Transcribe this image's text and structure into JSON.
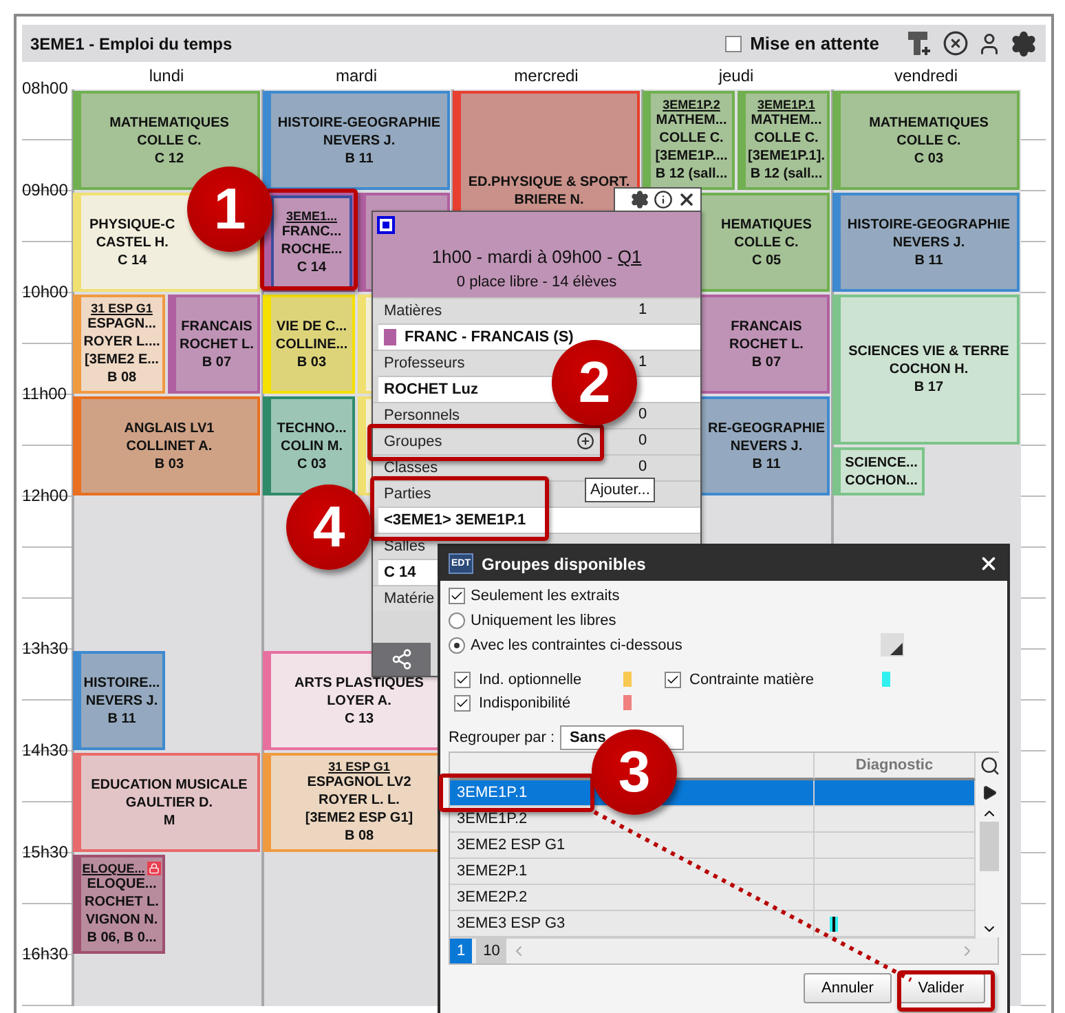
{
  "window": {
    "title": "3EME1 - Emploi du temps",
    "hold": {
      "label": "Mise en attente",
      "checked": false
    }
  },
  "timetable": {
    "days": [
      "lundi",
      "mardi",
      "mercredi",
      "jeudi",
      "vendredi"
    ],
    "periods": [
      {
        "time": "08h00",
        "lessons_by_day": {
          "day_1": [
            {
              "kind": "hour",
              "color": "#a5c196",
              "bar": {
                "color": "#70b050"
              },
              "selected": false,
              "locked": false,
              "lines": [
                "MATHEMATIQUES",
                "COLLE C.",
                "C 12"
              ]
            }
          ],
          "day_2": [
            {
              "kind": "hour",
              "color": "#94a9bf",
              "bar": {
                "color": "#3e8ad0"
              },
              "selected": false,
              "locked": false,
              "lines": [
                "HISTOIRE-GEOGRAPHIE",
                "NEVERS J.",
                "B 11"
              ]
            }
          ],
          "day_3": [
            {
              "kind": "double",
              "color": "#c99189",
              "bar": {
                "color": "#e84030"
              },
              "selected": false,
              "locked": false,
              "lines": [
                "ED.PHYSIQUE & SPORT.",
                "BRIERE N."
              ]
            }
          ],
          "day_4": [
            {
              "kind": "half-left",
              "color": "#a5c196",
              "bar": {
                "color": "#70b050"
              },
              "selected": false,
              "locked": false,
              "header": "3EME1P.2",
              "lines": [
                "MATHEM...",
                "COLLE C.",
                "[3EME1P....",
                "B 12 (sall..."
              ]
            },
            {
              "kind": "half-right",
              "color": "#a5c196",
              "bar": {
                "color": "#70b050"
              },
              "selected": false,
              "locked": false,
              "header": "3EME1P.1",
              "lines": [
                "MATHEM...",
                "COLLE C.",
                "[3EME1P.1].",
                "B 12 (sall..."
              ]
            }
          ],
          "day_5": [
            {
              "kind": "hour",
              "color": "#a5c196",
              "bar": {
                "color": "#70b050"
              },
              "selected": false,
              "locked": false,
              "lines": [
                "MATHEMATIQUES",
                "COLLE C.",
                "C 03"
              ]
            }
          ]
        }
      },
      {
        "time": "09h00",
        "lessons_by_day": {
          "day_1": [
            {
              "kind": "hour-text-left",
              "color": "#f2eedd",
              "bar": {
                "color": "#f0e070"
              },
              "selected": false,
              "locked": false,
              "lines": [
                "PHYSIQUE-C",
                "CASTEL H.",
                "C 14"
              ]
            }
          ],
          "day_2": [
            {
              "kind": "half-left",
              "color": "#bf93b6",
              "bar": {
                "color": "#b060a0"
              },
              "selected": true,
              "locked": false,
              "header": "3EME1...",
              "lines": [
                "FRANC...",
                "ROCHE...",
                "C 14"
              ]
            },
            {
              "kind": "half-right",
              "color": "#bf93b6",
              "bar": {
                "color": "#b060a0"
              },
              "selected": false,
              "locked": false
            }
          ],
          "day_4": [
            {
              "kind": "hour-text-right",
              "color": "#a5c196",
              "bar": {
                "color": "#70b050"
              },
              "selected": false,
              "locked": false,
              "lines": [
                "HEMATIQUES",
                "COLLE C.",
                "C 05"
              ]
            }
          ],
          "day_5": [
            {
              "kind": "hour",
              "color": "#94a9bf",
              "bar": {
                "color": "#3e8ad0"
              },
              "selected": false,
              "locked": false,
              "lines": [
                "HISTOIRE-GEOGRAPHIE",
                "NEVERS J.",
                "B 11"
              ]
            }
          ]
        }
      },
      {
        "time": "10h00",
        "lessons_by_day": {
          "day_1": [
            {
              "kind": "half-left",
              "color": "#efd8c4",
              "bar": {
                "color": "#f09a40"
              },
              "selected": false,
              "locked": false,
              "header": "31 ESP G1",
              "lines": [
                "ESPAGN...",
                "ROYER L....",
                "[3EME2 E...",
                "B 08"
              ]
            },
            {
              "kind": "half-right",
              "color": "#bf93b6",
              "bar": {
                "color": "#b060a0"
              },
              "selected": false,
              "locked": false,
              "lines": [
                "FRANCAIS",
                "ROCHET L.",
                "B 07"
              ]
            }
          ],
          "day_2": [
            {
              "kind": "half-left",
              "color": "#ddd47a",
              "bar": {
                "color": "#f5e000"
              },
              "selected": false,
              "locked": false,
              "lines": [
                "VIE DE C...",
                "COLLINE...",
                "B 03"
              ]
            },
            {
              "kind": "half-right",
              "color": "#f3efd8",
              "bar": {
                "color": "#f0e070"
              },
              "selected": false,
              "locked": false
            }
          ],
          "day_4": [
            {
              "kind": "hour-text-right",
              "color": "#bf93b6",
              "bar": {
                "color": "#b060a0"
              },
              "selected": false,
              "locked": false,
              "lines": [
                "FRANCAIS",
                "ROCHET L.",
                "B 07"
              ]
            }
          ],
          "day_5": [
            {
              "kind": "long",
              "color": "#cde3d2",
              "bar": {
                "color": "#7cc48a"
              },
              "selected": false,
              "locked": false,
              "lines": [
                "SCIENCES VIE & TERRE",
                "COCHON H.",
                "B 17"
              ]
            }
          ]
        }
      },
      {
        "time": "11h00",
        "lessons_by_day": {
          "day_1": [
            {
              "kind": "hour",
              "color": "#cfa286",
              "bar": {
                "color": "#e87020"
              },
              "selected": false,
              "locked": false,
              "lines": [
                "ANGLAIS LV1",
                "COLLINET A.",
                "B 03"
              ]
            }
          ],
          "day_2": [
            {
              "kind": "half-left",
              "color": "#9cc5b6",
              "bar": {
                "color": "#2f8a6a"
              },
              "selected": false,
              "locked": false,
              "lines": [
                "TECHNO...",
                "COLIN M.",
                "C 03"
              ]
            },
            {
              "kind": "half-right",
              "color": "#f3efd8",
              "bar": {
                "color": "#f0e070"
              },
              "selected": false,
              "locked": false
            }
          ],
          "day_4": [
            {
              "kind": "hour-text-right",
              "color": "#94a9bf",
              "bar": {
                "color": "#3e8ad0"
              },
              "selected": false,
              "locked": false,
              "lines": [
                "RE-GEOGRAPHIE",
                "NEVERS J.",
                "B 11"
              ]
            }
          ],
          "day_5": [
            {
              "kind": "late-half-left",
              "color": "#cde3d2",
              "bar": {
                "color": "#7cc48a"
              },
              "selected": false,
              "locked": false,
              "lines": [
                "SCIENCE...",
                "COCHON..."
              ]
            }
          ]
        }
      },
      {
        "time": "12h00"
      },
      {
        "time": "13h30",
        "lessons_by_day": {
          "day_1": [
            {
              "kind": "half-left",
              "color": "#94a9bf",
              "bar": {
                "color": "#3e8ad0"
              },
              "selected": false,
              "locked": false,
              "lines": [
                "HISTOIRE...",
                "NEVERS J.",
                "B 11"
              ]
            }
          ],
          "day_2": [
            {
              "kind": "hour",
              "color": "#f2e3e9",
              "bar": {
                "color": "#e870a0"
              },
              "selected": false,
              "locked": false,
              "lines": [
                "ARTS PLASTIQUES",
                "LOYER A.",
                "C 13"
              ]
            }
          ]
        }
      },
      {
        "time": "14h30",
        "lessons_by_day": {
          "day_1": [
            {
              "kind": "hour",
              "color": "#e3c4c6",
              "bar": {
                "color": "#e86a6a"
              },
              "selected": false,
              "locked": false,
              "lines": [
                "EDUCATION MUSICALE",
                "GAULTIER D.",
                "M"
              ]
            }
          ],
          "day_2": [
            {
              "kind": "hour",
              "color": "#ecd6c0",
              "bar": {
                "color": "#f09a40"
              },
              "selected": false,
              "locked": false,
              "header": "31 ESP G1",
              "lines": [
                "ESPAGNOL LV2",
                "ROYER L. L.",
                "[3EME2 ESP G1]",
                "B 08"
              ]
            }
          ]
        }
      },
      {
        "time": "15h30",
        "lessons_by_day": {
          "day_1": [
            {
              "kind": "half-left",
              "color": "#b98c9d",
              "bar": {
                "color": "#a05070"
              },
              "selected": false,
              "locked": true,
              "header": "ELOQUE...",
              "lines": [
                "ELOQUE...",
                "ROCHET L.",
                "VIGNON N.",
                "B 06, B 0..."
              ]
            }
          ]
        }
      },
      {
        "time": "16h30"
      }
    ]
  },
  "lesson_card": {
    "summary": "1h00  -  mardi à 09h00  -",
    "week_link": "Q1",
    "places": "0 place libre  -  14 élèves",
    "sections": [
      {
        "label": "Matières",
        "count": "1",
        "add_button": false,
        "entries": [
          {
            "text": "FRANC - FRANCAIS (S)",
            "color": "#b060a0"
          }
        ]
      },
      {
        "label": "Professeurs",
        "count": "1",
        "add_button": false,
        "entries": [
          {
            "text": "ROCHET Luz"
          }
        ]
      },
      {
        "label": "Personnels",
        "count": "0",
        "add_button": false
      },
      {
        "label": "Groupes",
        "count": "0",
        "add_button": true
      },
      {
        "label": "Classes",
        "count": "0",
        "add_button": false
      },
      {
        "label": "Parties",
        "add_button": false,
        "entries": [
          {
            "text": "<3EME1> 3EME1P.1"
          }
        ]
      },
      {
        "label": "Salles",
        "add_button": false,
        "entries": [
          {
            "text": "C 14"
          }
        ]
      },
      {
        "label": "Matérie",
        "add_button": false
      }
    ],
    "tooltip": "Ajouter..."
  },
  "dialog": {
    "logo": "EDT",
    "title": "Groupes disponibles",
    "options": [
      {
        "kind": "checkbox",
        "label": "Seulement les extraits",
        "checked": true
      },
      {
        "kind": "radio",
        "label": "Uniquement les libres",
        "selected": false
      },
      {
        "kind": "radio",
        "label": "Avec les contraintes ci-dessous",
        "selected": true
      }
    ],
    "constraints": [
      {
        "label": "Ind. optionnelle",
        "checked": true,
        "color": "#f8c850"
      },
      {
        "label": "Contrainte matière",
        "checked": true,
        "color": "#30f0f0"
      },
      {
        "label": "Indisponibilité",
        "checked": true,
        "color": "#f08080"
      }
    ],
    "group_by": {
      "label": "Regrouper par :",
      "value": "Sans"
    },
    "table": {
      "column_2": "Diagnostic",
      "rows": [
        {
          "name": "3EME1P.1",
          "selected": true,
          "flagged": false
        },
        {
          "name": "3EME1P.2",
          "selected": false,
          "flagged": false
        },
        {
          "name": "3EME2 ESP G1",
          "selected": false,
          "flagged": false
        },
        {
          "name": "3EME2P.1",
          "selected": false,
          "flagged": false
        },
        {
          "name": "3EME2P.2",
          "selected": false,
          "flagged": false
        },
        {
          "name": "3EME3 ESP G3",
          "selected": false,
          "flagged": true
        }
      ]
    },
    "pager": [
      {
        "label": "1",
        "selected": true
      },
      {
        "label": "10",
        "selected": false
      }
    ],
    "buttons": [
      "Annuler",
      "Valider"
    ]
  },
  "callouts": [
    "1",
    "2",
    "3",
    "4"
  ]
}
